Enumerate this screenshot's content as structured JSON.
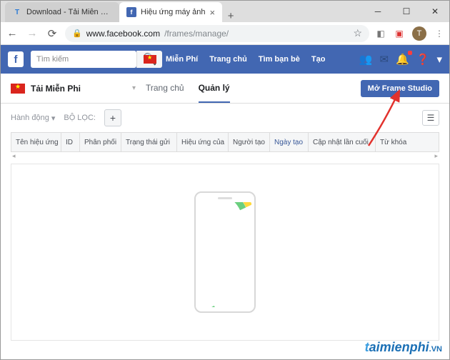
{
  "browser": {
    "tabs": [
      {
        "title": "Download - Tải Miễn Phí VN - Ph",
        "icon": "T"
      },
      {
        "title": "Hiệu ứng máy ảnh",
        "icon": "f"
      }
    ],
    "url_host": "www.facebook.com",
    "url_path": "/frames/manage/",
    "avatar_letter": "T"
  },
  "fb": {
    "search_placeholder": "Tìm kiếm",
    "nav": {
      "mienphi": "Miễn Phí",
      "trangchu": "Trang chủ",
      "timbanbe": "Tìm bạn bè",
      "tao": "Tạo"
    }
  },
  "page": {
    "name": "Tải Miễn Phi",
    "tab_home": "Trang chủ",
    "tab_manage": "Quản lý",
    "open_studio": "Mở Frame Studio"
  },
  "filters": {
    "action": "Hành động",
    "filter_label": "BỘ LỌC:"
  },
  "table": {
    "cols": {
      "name": "Tên hiệu ứng",
      "id": "ID",
      "dist": "Phân phối",
      "status": "Trạng thái gửi",
      "effect_of": "Hiệu ứng của",
      "creator": "Người tạo",
      "created": "Ngày tạo",
      "updated": "Cập nhật lần cuối",
      "keywords": "Từ khóa"
    }
  },
  "watermark": {
    "t": "t",
    "rest": "aimienphi",
    "vn": ".VN"
  }
}
